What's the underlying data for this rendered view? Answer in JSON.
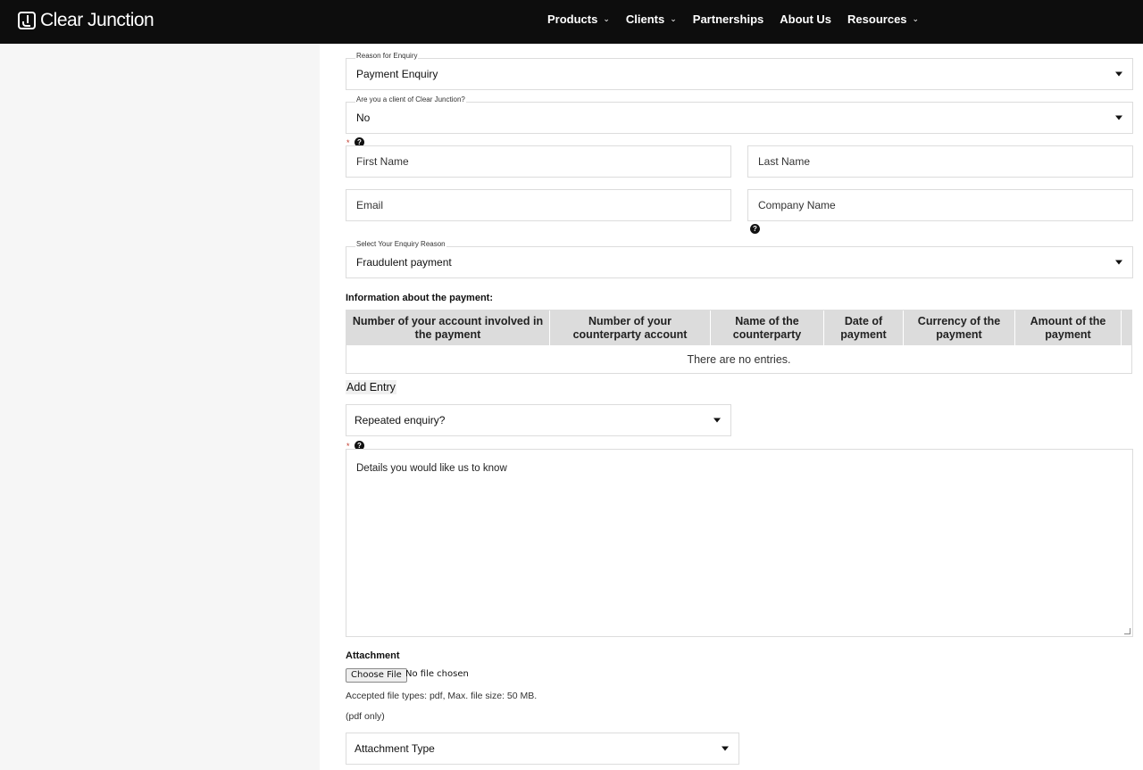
{
  "nav": {
    "brand": "Clear Junction",
    "items": [
      {
        "label": "Products",
        "has_menu": true
      },
      {
        "label": "Clients",
        "has_menu": true
      },
      {
        "label": "Partnerships",
        "has_menu": false
      },
      {
        "label": "About Us",
        "has_menu": false
      },
      {
        "label": "Resources",
        "has_menu": true
      }
    ],
    "chevron": "⌄"
  },
  "form": {
    "reason": {
      "label": "Reason for Enquiry",
      "value": "Payment Enquiry"
    },
    "client": {
      "label": "Are you a client of Clear Junction?",
      "value": "No"
    },
    "required_mark": "*",
    "help_glyph": "?",
    "first_name": {
      "placeholder": "First Name"
    },
    "last_name": {
      "placeholder": "Last Name"
    },
    "email": {
      "placeholder": "Email"
    },
    "company": {
      "placeholder": "Company Name"
    },
    "enquiry_reason": {
      "label": "Select Your Enquiry Reason",
      "value": "Fraudulent payment"
    },
    "payment_section_title": "Information about the payment:",
    "table": {
      "columns": [
        "Number of your account involved in the payment",
        "Number of your counterparty account",
        "Name of the counterparty",
        "Date of payment",
        "Currency of the payment",
        "Amount of the payment"
      ],
      "empty_text": "There are no entries."
    },
    "add_entry": "Add Entry",
    "repeated": {
      "value": "Repeated enquiry?"
    },
    "details": {
      "placeholder": "Details you would like us to know"
    },
    "attachment": {
      "title": "Attachment",
      "button": "Choose File",
      "status": "No file chosen",
      "accepted": "Accepted file types: pdf, Max. file size: 50 MB.",
      "note": "(pdf only)"
    },
    "attachment_type": {
      "value": "Attachment Type"
    }
  }
}
